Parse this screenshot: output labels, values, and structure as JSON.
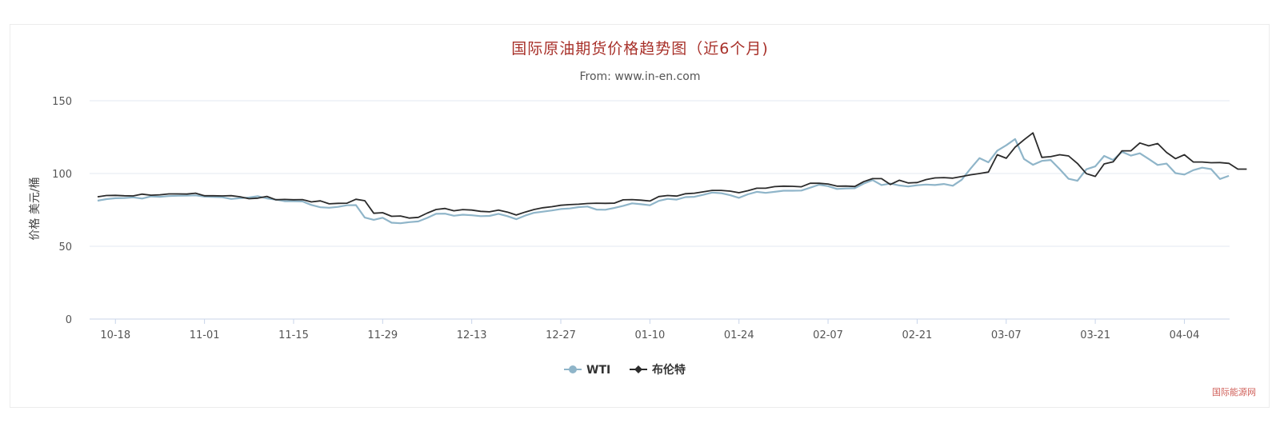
{
  "watermark": "国际能源网",
  "chart_data": {
    "type": "line",
    "title": "国际原油期货价格趋势图（近6个月)",
    "subtitle": "From: www.in-en.com",
    "ylabel": "价格 美元/桶",
    "xlabel": "",
    "ylim": [
      0,
      150
    ],
    "yticks": [
      0,
      50,
      100,
      150
    ],
    "x_tick_labels": [
      "10-18",
      "11-01",
      "11-15",
      "11-29",
      "12-13",
      "12-27",
      "01-10",
      "01-24",
      "02-07",
      "02-21",
      "03-07",
      "03-21",
      "04-04"
    ],
    "grid": true,
    "legend_position": "bottom-center",
    "dates": [
      "10-14",
      "10-15",
      "10-18",
      "10-19",
      "10-20",
      "10-21",
      "10-22",
      "10-25",
      "10-26",
      "10-27",
      "10-28",
      "10-29",
      "11-01",
      "11-02",
      "11-03",
      "11-04",
      "11-05",
      "11-08",
      "11-09",
      "11-10",
      "11-11",
      "11-12",
      "11-15",
      "11-16",
      "11-17",
      "11-18",
      "11-19",
      "11-22",
      "11-23",
      "11-24",
      "11-25",
      "11-26",
      "11-29",
      "11-30",
      "12-01",
      "12-02",
      "12-03",
      "12-06",
      "12-07",
      "12-08",
      "12-09",
      "12-10",
      "12-13",
      "12-14",
      "12-15",
      "12-16",
      "12-17",
      "12-20",
      "12-21",
      "12-22",
      "12-23",
      "12-24",
      "12-27",
      "12-28",
      "12-29",
      "12-30",
      "12-31",
      "01-03",
      "01-04",
      "01-05",
      "01-06",
      "01-07",
      "01-10",
      "01-11",
      "01-12",
      "01-13",
      "01-14",
      "01-17",
      "01-18",
      "01-19",
      "01-20",
      "01-21",
      "01-24",
      "01-25",
      "01-26",
      "01-27",
      "01-28",
      "01-31",
      "02-01",
      "02-02",
      "02-03",
      "02-04",
      "02-07",
      "02-08",
      "02-09",
      "02-10",
      "02-11",
      "02-14",
      "02-15",
      "02-16",
      "02-17",
      "02-18",
      "02-21",
      "02-22",
      "02-23",
      "02-24",
      "02-25",
      "02-28",
      "03-01",
      "03-02",
      "03-03",
      "03-04",
      "03-07",
      "03-08",
      "03-09",
      "03-10",
      "03-11",
      "03-14",
      "03-15",
      "03-16",
      "03-17",
      "03-18",
      "03-21",
      "03-22",
      "03-23",
      "03-24",
      "03-25",
      "03-28",
      "03-29",
      "03-30",
      "03-31",
      "04-01",
      "04-04",
      "04-05",
      "04-06",
      "04-07",
      "04-08"
    ],
    "series": [
      {
        "name": "WTI",
        "color": "#8fb5c9",
        "marker": "circle",
        "values": [
          81.3,
          82.4,
          83.0,
          83.2,
          83.6,
          82.8,
          84.3,
          84.0,
          84.5,
          84.7,
          84.8,
          85.0,
          84.1,
          83.9,
          83.7,
          82.5,
          83.1,
          83.5,
          84.4,
          82.9,
          82.1,
          81.0,
          81.0,
          80.8,
          78.4,
          76.8,
          76.5,
          77.1,
          78.2,
          78.3,
          69.7,
          68.2,
          69.6,
          66.2,
          65.8,
          66.6,
          67.1,
          69.5,
          72.3,
          72.4,
          71.0,
          71.7,
          71.3,
          70.7,
          70.9,
          72.3,
          70.7,
          68.6,
          71.1,
          73.0,
          73.8,
          74.6,
          75.6,
          76.0,
          76.9,
          77.3,
          75.2,
          75.1,
          76.3,
          77.8,
          79.5,
          78.9,
          78.2,
          81.2,
          82.6,
          82.1,
          83.8,
          84.0,
          85.4,
          86.9,
          86.5,
          85.1,
          83.3,
          85.7,
          87.4,
          86.7,
          87.4,
          88.2,
          88.2,
          88.3,
          90.3,
          92.3,
          91.3,
          89.4,
          89.7,
          89.9,
          93.1,
          95.5,
          92.1,
          93.1,
          91.8,
          91.1,
          91.9,
          92.4,
          92.1,
          92.8,
          91.6,
          95.7,
          103.4,
          110.6,
          107.7,
          115.7,
          119.4,
          123.7,
          110.0,
          106.0,
          108.7,
          109.3,
          103.0,
          96.4,
          95.0,
          102.9,
          104.9,
          112.1,
          109.3,
          114.9,
          112.3,
          113.9,
          110.0,
          105.9,
          106.8,
          100.3,
          99.3,
          102.3,
          104.0,
          103.0,
          96.2,
          98.4
        ]
      },
      {
        "name": "布伦特",
        "color": "#2b2b2b",
        "marker": "diamond",
        "values": [
          84.0,
          84.9,
          85.0,
          84.7,
          84.6,
          85.8,
          85.1,
          85.4,
          86.0,
          86.0,
          85.9,
          86.5,
          84.7,
          84.7,
          84.6,
          84.8,
          84.0,
          82.7,
          83.1,
          84.3,
          82.0,
          82.2,
          82.0,
          82.1,
          80.5,
          81.2,
          79.2,
          79.5,
          79.6,
          82.3,
          81.3,
          72.7,
          73.1,
          70.6,
          70.8,
          69.4,
          69.9,
          72.8,
          75.3,
          76.0,
          74.4,
          75.2,
          74.9,
          74.0,
          73.7,
          74.9,
          73.5,
          71.5,
          73.5,
          75.3,
          76.5,
          77.2,
          78.2,
          78.6,
          78.9,
          79.4,
          79.6,
          79.5,
          79.6,
          81.9,
          82.1,
          81.7,
          81.1,
          84.2,
          84.9,
          84.5,
          86.1,
          86.5,
          87.4,
          88.4,
          88.4,
          87.9,
          86.8,
          88.2,
          89.9,
          89.9,
          91.0,
          91.3,
          91.2,
          90.9,
          93.3,
          93.3,
          92.8,
          91.3,
          91.4,
          91.1,
          94.4,
          96.5,
          96.5,
          92.5,
          95.4,
          93.5,
          93.8,
          95.8,
          97.0,
          97.2,
          96.8,
          97.9,
          99.1,
          100.0,
          101.0,
          112.9,
          110.5,
          118.1,
          123.2,
          127.9,
          111.1,
          111.6,
          112.9,
          112.1,
          106.9,
          99.9,
          98.0,
          106.6,
          108.0,
          115.6,
          115.6,
          121.0,
          119.0,
          120.6,
          114.5,
          110.2,
          112.9,
          107.9,
          107.9,
          107.4,
          107.5,
          107.0,
          103.0,
          103.0
        ]
      }
    ]
  }
}
